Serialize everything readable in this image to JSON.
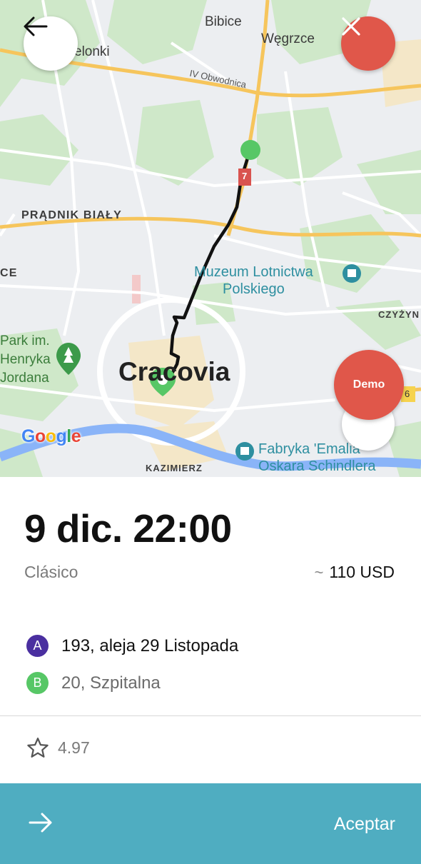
{
  "map": {
    "labels": {
      "bibice": "Bibice",
      "wegrzce": "Węgrzce",
      "zielonki": "elonki",
      "obwodnica": "IV Obwodnica",
      "road7": "7",
      "pradnik": "PRĄDNIK BIAŁY",
      "ce": "CE",
      "muzeum": "Muzeum Lotnictwa\nPolskiego",
      "czyzyny": "CZYŻYN",
      "park": "Park im.\nHenryka\nJordana",
      "city": "Cracovia",
      "kazimierz": "KAZIMIERZ",
      "fabryka": "Fabryka 'Emalia'\nOskara Schindlera",
      "road_side": "6"
    },
    "google_logo": [
      "G",
      "o",
      "o",
      "g",
      "l",
      "e"
    ],
    "demo_label": "Demo",
    "route_color": "#111111",
    "origin_color": "#57c766"
  },
  "controls": {
    "back_icon": "arrow-left-icon",
    "close_icon": "close-icon",
    "locate_icon": "navigation-arrow-icon"
  },
  "trip": {
    "datetime": "9 dic. 22:00",
    "fare_type": "Clásico",
    "price_prefix": "~",
    "price": "110 USD",
    "stops": [
      {
        "badge": "A",
        "address": "193, aleja 29 Listopada",
        "color": "#4a2fa0"
      },
      {
        "badge": "B",
        "address": "20, Szpitalna",
        "color": "#57c766"
      }
    ],
    "rating": "4.97"
  },
  "accept": {
    "label": "Aceptar",
    "color": "#4fadc1",
    "icon": "arrow-right-icon"
  }
}
